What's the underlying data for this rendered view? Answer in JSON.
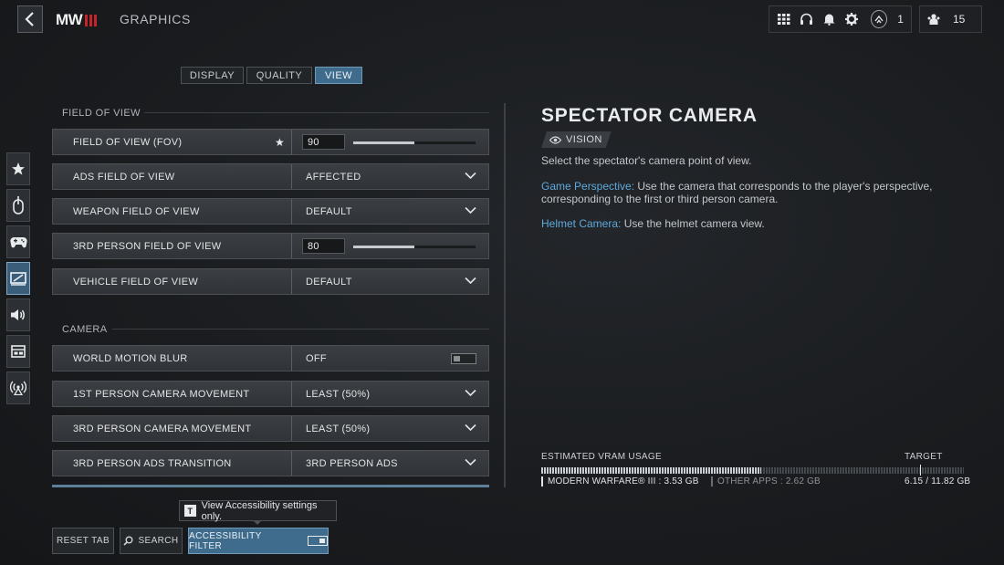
{
  "header": {
    "logo_text": "MW",
    "page_title": "GRAPHICS",
    "rank_level": "1",
    "friends_count": "15",
    "icons": [
      "grid-icon",
      "headset-icon",
      "bell-icon",
      "gear-icon",
      "rank-icon",
      "friends-icon"
    ]
  },
  "tabs": [
    {
      "label": "DISPLAY",
      "active": false
    },
    {
      "label": "QUALITY",
      "active": false
    },
    {
      "label": "VIEW",
      "active": true
    }
  ],
  "rail": [
    "star-icon",
    "mouse-icon",
    "controller-icon",
    "graphics-icon",
    "audio-icon",
    "interface-icon",
    "network-icon"
  ],
  "sections": {
    "fov": {
      "title": "FIELD OF VIEW",
      "rows": [
        {
          "label": "FIELD OF VIEW (FOV)",
          "value": "90",
          "type": "slider",
          "fill": 0.5,
          "favorite": true
        },
        {
          "label": "ADS FIELD OF VIEW",
          "value": "AFFECTED",
          "type": "dropdown"
        },
        {
          "label": "WEAPON FIELD OF VIEW",
          "value": "DEFAULT",
          "type": "dropdown"
        },
        {
          "label": "3RD PERSON FIELD OF VIEW",
          "value": "80",
          "type": "slider",
          "fill": 0.5
        },
        {
          "label": "VEHICLE FIELD OF VIEW",
          "value": "DEFAULT",
          "type": "dropdown"
        }
      ]
    },
    "camera": {
      "title": "CAMERA",
      "rows": [
        {
          "label": "WORLD MOTION BLUR",
          "value": "OFF",
          "type": "toggle"
        },
        {
          "label": "1ST PERSON CAMERA MOVEMENT",
          "value": "LEAST (50%)",
          "type": "dropdown"
        },
        {
          "label": "3RD PERSON CAMERA MOVEMENT",
          "value": "LEAST (50%)",
          "type": "dropdown"
        },
        {
          "label": "3RD PERSON ADS TRANSITION",
          "value": "3RD PERSON ADS",
          "type": "dropdown"
        }
      ]
    }
  },
  "detail": {
    "title": "SPECTATOR CAMERA",
    "tag": "VISION",
    "description": "Select the spectator's camera point of view.",
    "opt1_name": "Game Perspective:",
    "opt1_text": " Use the camera that corresponds to the player's perspective, corresponding to the first or third person camera.",
    "opt2_name": "Helmet Camera:",
    "opt2_text": " Use the helmet camera view."
  },
  "vram": {
    "title": "ESTIMATED VRAM USAGE",
    "target_label": "TARGET",
    "mw_usage": "MODERN WARFARE® III : 3.53 GB",
    "other_usage": "OTHER APPS : 2.62 GB",
    "total": "6.15 / 11.82 GB",
    "used_fraction": 0.52
  },
  "bottom": {
    "tooltip_key": "T",
    "tooltip_text": "View Accessibility settings only.",
    "reset_label": "RESET TAB",
    "search_label": "SEARCH",
    "accessibility_label": "ACCESSIBILITY FILTER"
  }
}
